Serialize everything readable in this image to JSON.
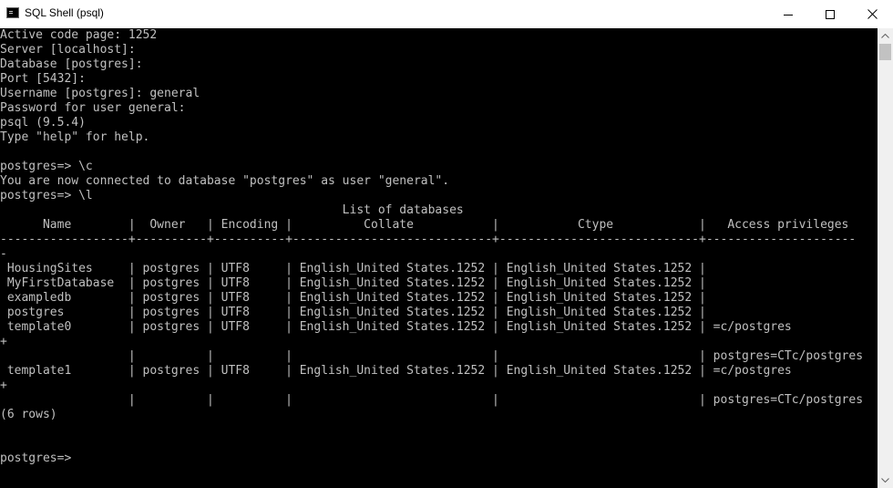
{
  "window": {
    "title": "SQL Shell (psql)"
  },
  "icons": {
    "app": "console-window-icon",
    "minimize": "minimize-icon",
    "maximize": "maximize-icon",
    "close": "close-icon",
    "scroll_up": "scroll-up-arrow-icon",
    "scroll_down": "scroll-down-arrow-icon"
  },
  "console": {
    "lines": [
      "Active code page: 1252",
      "Server [localhost]:",
      "Database [postgres]:",
      "Port [5432]:",
      "Username [postgres]: general",
      "Password for user general:",
      "psql (9.5.4)",
      "Type \"help\" for help.",
      "",
      "postgres=> \\c",
      "You are now connected to database \"postgres\" as user \"general\".",
      "postgres=> \\l",
      "                                                List of databases",
      "      Name        |  Owner   | Encoding |          Collate           |           Ctype            |   Access privileges",
      "------------------+----------+----------+----------------------------+----------------------------+---------------------",
      "-",
      " HousingSites     | postgres | UTF8     | English_United States.1252 | English_United States.1252 |",
      " MyFirstDatabase  | postgres | UTF8     | English_United States.1252 | English_United States.1252 |",
      " exampledb        | postgres | UTF8     | English_United States.1252 | English_United States.1252 |",
      " postgres         | postgres | UTF8     | English_United States.1252 | English_United States.1252 |",
      " template0        | postgres | UTF8     | English_United States.1252 | English_United States.1252 | =c/postgres",
      "+",
      "                  |          |          |                            |                            | postgres=CTc/postgres",
      " template1        | postgres | UTF8     | English_United States.1252 | English_United States.1252 | =c/postgres",
      "+",
      "                  |          |          |                            |                            | postgres=CTc/postgres",
      "(6 rows)",
      "",
      "",
      "postgres=>"
    ]
  }
}
